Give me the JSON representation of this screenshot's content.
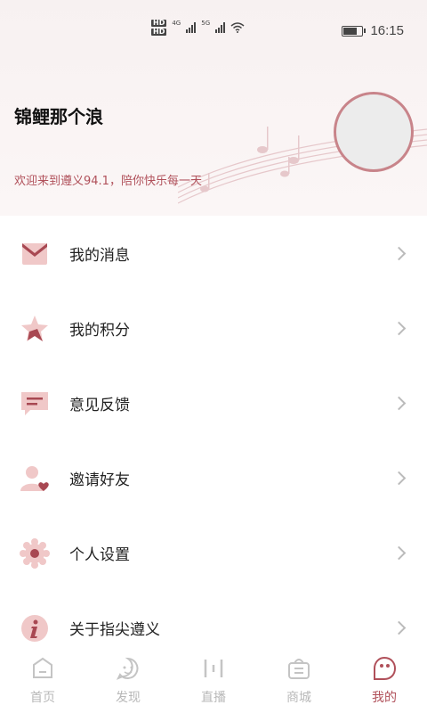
{
  "status_bar": {
    "hd1": "HD",
    "hd2": "HD",
    "net1": "4G",
    "net2": "5G",
    "time": "16:15",
    "battery_level": 0.85
  },
  "profile": {
    "username": "锦鲤那个浪",
    "welcome": "欢迎来到遵义94.1，陪你快乐每一天"
  },
  "menu": {
    "items": [
      {
        "label": "我的消息",
        "icon": "envelope-icon"
      },
      {
        "label": "我的积分",
        "icon": "star-icon"
      },
      {
        "label": "意见反馈",
        "icon": "feedback-icon"
      },
      {
        "label": "邀请好友",
        "icon": "invite-friend-icon"
      },
      {
        "label": "个人设置",
        "icon": "settings-icon"
      },
      {
        "label": "关于指尖遵义",
        "icon": "info-icon"
      }
    ]
  },
  "tabbar": {
    "tabs": [
      {
        "label": "首页",
        "icon": "home-icon"
      },
      {
        "label": "发现",
        "icon": "discover-icon"
      },
      {
        "label": "直播",
        "icon": "live-icon"
      },
      {
        "label": "商城",
        "icon": "shop-icon"
      },
      {
        "label": "我的",
        "icon": "mine-icon"
      }
    ],
    "active_index": 4
  },
  "colors": {
    "accent": "#b0505a",
    "icon_dark": "#a84852",
    "icon_light": "#f0c8c8"
  }
}
